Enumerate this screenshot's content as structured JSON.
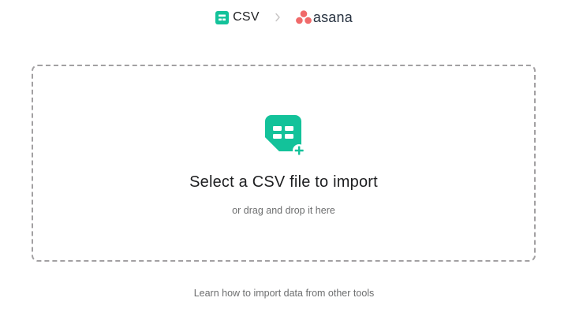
{
  "header": {
    "source_label": "CSV",
    "source_icon": "csv-file-icon",
    "separator_icon": "chevron-right-icon",
    "target_label": "asana",
    "target_icon": "asana-logo-icon"
  },
  "dropzone": {
    "icon": "csv-file-add-icon",
    "title": "Select a CSV file to import",
    "subtitle": "or drag and drop it here"
  },
  "footer": {
    "learn_link": "Learn how to import data from other tools"
  },
  "colors": {
    "csv_green": "#13c29a",
    "asana_coral": "#f06a6a",
    "text_primary": "#1e1f21",
    "text_secondary": "#6d6e6f",
    "border_dashed": "#a2a0a2"
  }
}
